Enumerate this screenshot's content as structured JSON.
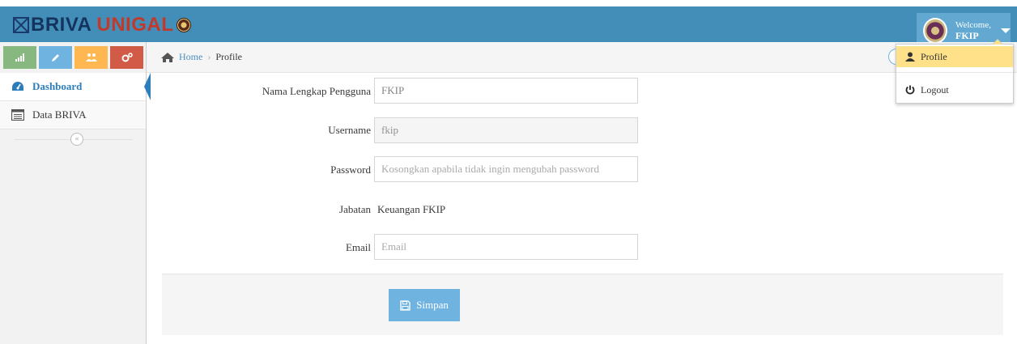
{
  "brand": {
    "briva": "BRIVA",
    "unigal": "UNIGAL"
  },
  "user_menu": {
    "welcome": "Welcome,",
    "name": "FKIP"
  },
  "dropdown": {
    "profile": "Profile",
    "logout": "Logout"
  },
  "sidebar": {
    "items": [
      {
        "label": "Dashboard",
        "icon": "tachometer-icon",
        "active": true
      },
      {
        "label": "Data BRIVA",
        "icon": "list-alt-icon",
        "active": false
      }
    ],
    "collapse_glyph": "«"
  },
  "breadcrumb": {
    "home": "Home",
    "separator": "›",
    "current": "Profile"
  },
  "form": {
    "full_name": {
      "label": "Nama Lengkap Pengguna",
      "value": "FKIP"
    },
    "username": {
      "label": "Username",
      "value": "fkip"
    },
    "password": {
      "label": "Password",
      "placeholder": "Kosongkan apabila tidak ingin mengubah password"
    },
    "position": {
      "label": "Jabatan",
      "value": "Keuangan FKIP"
    },
    "email": {
      "label": "Email",
      "placeholder": "Email"
    },
    "save_label": "Simpan"
  },
  "colors": {
    "navbar": "#438eb9",
    "user_menu": "#62a8d1",
    "shortcut_green": "#87b87f",
    "shortcut_blue": "#6fb3e0",
    "shortcut_orange": "#ffb752",
    "shortcut_red": "#d15b47",
    "dropdown_highlight": "#fee188",
    "active_nav": "#2b7dbc"
  }
}
